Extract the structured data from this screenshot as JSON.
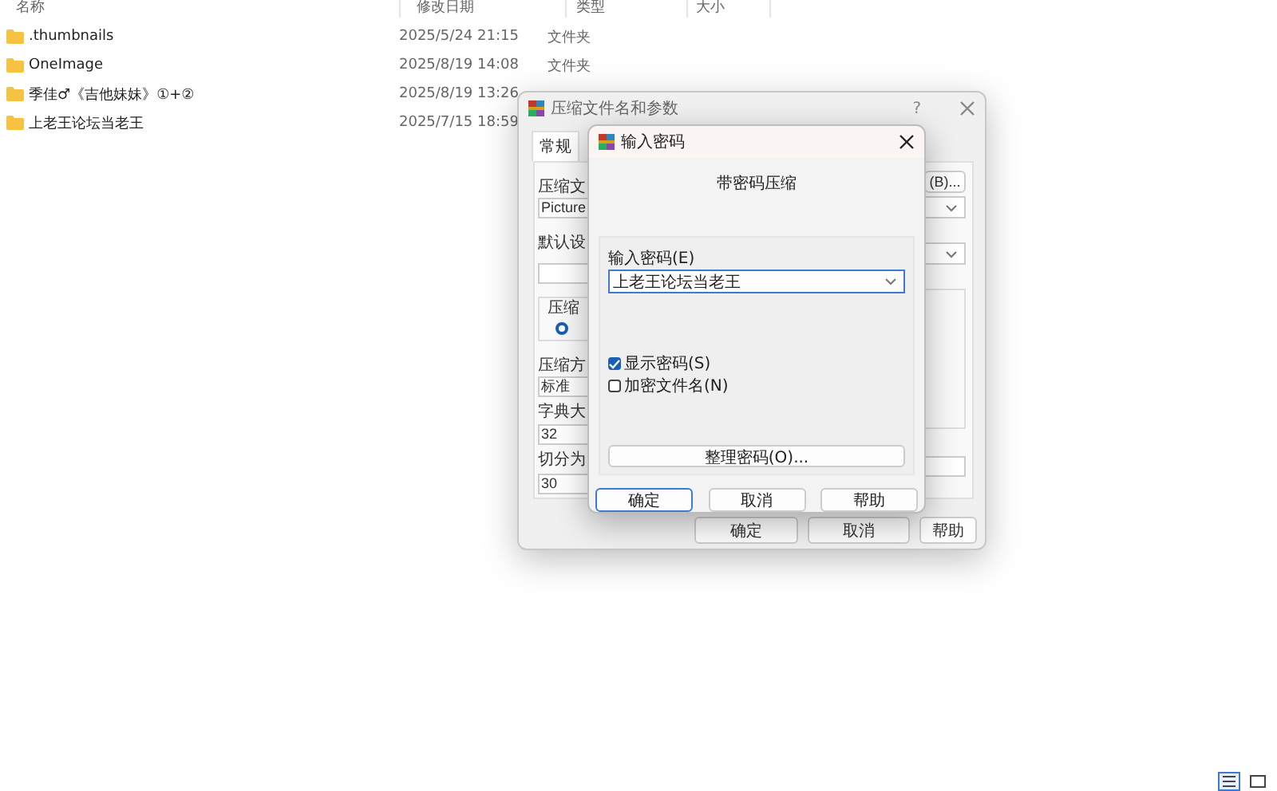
{
  "file_list": {
    "columns": [
      "名称",
      "修改日期",
      "类型",
      "大小"
    ],
    "rows": [
      {
        "name": ".thumbnails",
        "modified": "2025/5/24 21:15",
        "type": "文件夹"
      },
      {
        "name": "OneImage",
        "modified": "2025/8/19 14:08",
        "type": "文件夹"
      },
      {
        "name": "季佳♂《吉他妹妹》①+②",
        "modified": "2025/8/19 13:26"
      },
      {
        "name": "上老王论坛当老王",
        "modified": "2025/7/15 18:59"
      }
    ]
  },
  "archive_dialog": {
    "title": "压缩文件名和参数",
    "help_glyph": "?",
    "tabs": [
      {
        "label": "常规",
        "selected": true
      }
    ],
    "archive_label": "压缩文",
    "archive_name": "Picture",
    "profile_label": "默认设",
    "browse_button": "(B)...",
    "format_group_label": "压缩",
    "format_radio": {
      "selected": true
    },
    "method_label": "压缩方",
    "method_value": "标准",
    "dict_label": "字典大",
    "dict_value": "32",
    "split_label": "切分为",
    "split_value": "30",
    "buttons": [
      "确定",
      "取消",
      "帮助"
    ]
  },
  "password_dialog": {
    "title": "输入密码",
    "heading": "带密码压缩",
    "password_label": "输入密码(E)",
    "password_value": "上老王论坛当老王",
    "checkboxes": [
      {
        "label": "显示密码(S)",
        "checked": true
      },
      {
        "label": "加密文件名(N)",
        "checked": false
      }
    ],
    "organize_button": "整理密码(O)...",
    "buttons": [
      {
        "label": "确定",
        "selected": true
      },
      {
        "label": "取消",
        "selected": false
      },
      {
        "label": "帮助",
        "selected": false
      }
    ]
  },
  "view_toggle": [
    {
      "kind": "details",
      "selected": true
    },
    {
      "kind": "tiles",
      "selected": false
    }
  ]
}
